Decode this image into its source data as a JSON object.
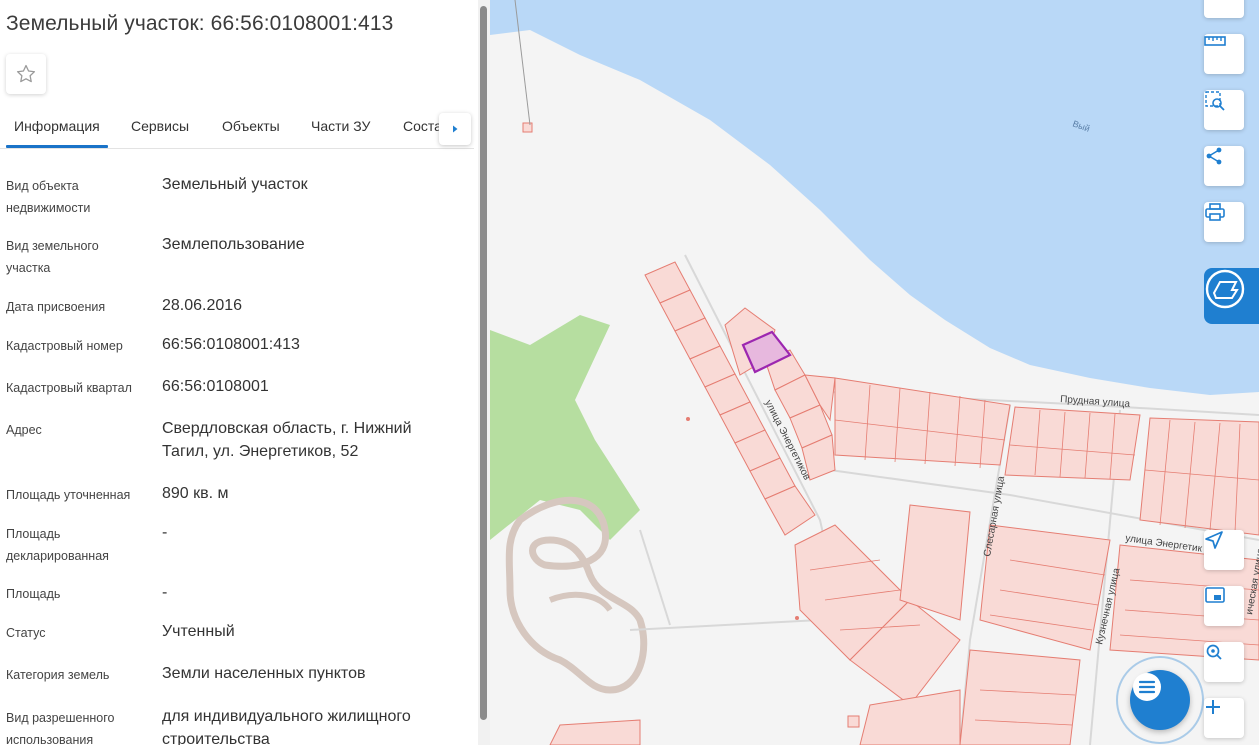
{
  "panel": {
    "title": "Земельный участок: 66:56:0108001:413",
    "tabs": [
      "Информация",
      "Сервисы",
      "Объекты",
      "Части ЗУ",
      "Соста"
    ],
    "rows": [
      {
        "label": "Вид объекта недвижимости",
        "value": "Земельный участок"
      },
      {
        "label": "Вид земельного участка",
        "value": "Землепользование"
      },
      {
        "label": "Дата присвоения",
        "value": "28.06.2016"
      },
      {
        "label": "Кадастровый номер",
        "value": "66:56:0108001:413"
      },
      {
        "label": "Кадастровый квартал",
        "value": "66:56:0108001"
      },
      {
        "label": "Адрес",
        "value": "Свердловская область, г. Нижний Тагил, ул. Энергетиков, 52"
      },
      {
        "label": "Площадь уточненная",
        "value": "890 кв. м"
      },
      {
        "label": "Площадь декларированная",
        "value": "-"
      },
      {
        "label": "Площадь",
        "value": "-"
      },
      {
        "label": "Статус",
        "value": "Учтенный"
      },
      {
        "label": "Категория земель",
        "value": "Земли населенных пунктов"
      },
      {
        "label": "Вид разрешенного использования",
        "value": "для индивидуального жилищного строительства"
      }
    ]
  },
  "map": {
    "labels": {
      "water": "Вый",
      "street1": "улица Энергетиков",
      "street2": "Прудная улица",
      "street3": "Слесарная улица",
      "street4": "улица Энергетик",
      "street5": "Кузнечная улица",
      "street6": "ическая улица"
    },
    "icons": [
      "layers-icon",
      "ruler-icon",
      "area-select-icon",
      "share-icon",
      "print-icon",
      "brand-logo-icon",
      "locate-icon",
      "minimap-icon",
      "search-location-icon",
      "zoom-in-icon",
      "chat-icon"
    ],
    "colors": {
      "water": "#b9d8f7",
      "park": "#b6dea0",
      "parcel": "#f9dad6",
      "parcel_stroke": "#e57d72",
      "selected": "#9c27b0",
      "accent": "#1f7fd0"
    }
  }
}
